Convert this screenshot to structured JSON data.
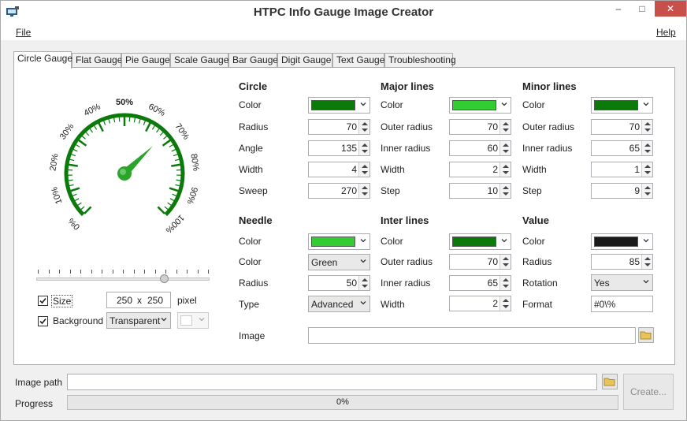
{
  "window": {
    "title": "HTPC Info Gauge Image Creator",
    "controls": [
      "–",
      "□",
      "✕"
    ]
  },
  "menu": {
    "file": "File",
    "help": "Help"
  },
  "tabs": [
    "Circle Gauge",
    "Flat Gauge",
    "Pie Gauge",
    "Scale Gauge",
    "Bar Gauge",
    "Digit Gauge",
    "Text Gauge",
    "Troubleshooting"
  ],
  "active_tab": "Circle Gauge",
  "preview": {
    "gauge_color": "#0b7a0b",
    "needle_color": "#2aa52a",
    "labels": [
      "0%",
      "10%",
      "20%",
      "30%",
      "40%",
      "50%",
      "60%",
      "70%",
      "80%",
      "90%",
      "100%"
    ],
    "value_percent": 67
  },
  "size": {
    "checkbox_label": "Size",
    "checked": true,
    "width": "250",
    "x": "x",
    "height": "250",
    "unit": "pixel",
    "slider_fraction": 0.74
  },
  "background": {
    "checkbox_label": "Background",
    "checked": true,
    "value": "Transparent"
  },
  "circle": {
    "heading": "Circle",
    "color_label": "Color",
    "color": "#0b7a0b",
    "radius_label": "Radius",
    "radius": "70",
    "angle_label": "Angle",
    "angle": "135",
    "width_label": "Width",
    "width": "4",
    "sweep_label": "Sweep",
    "sweep": "270"
  },
  "major_lines": {
    "heading": "Major lines",
    "color_label": "Color",
    "color": "#33cc33",
    "outer_radius_label": "Outer radius",
    "outer_radius": "70",
    "inner_radius_label": "Inner radius",
    "inner_radius": "60",
    "width_label": "Width",
    "width": "2",
    "step_label": "Step",
    "step": "10"
  },
  "minor_lines": {
    "heading": "Minor lines",
    "color_label": "Color",
    "color": "#0b7a0b",
    "outer_radius_label": "Outer radius",
    "outer_radius": "70",
    "inner_radius_label": "Inner radius",
    "inner_radius": "65",
    "width_label": "Width",
    "width": "1",
    "step_label": "Step",
    "step": "9"
  },
  "needle": {
    "heading": "Needle",
    "color_label": "Color",
    "color": "#33cc33",
    "color2_label": "Color",
    "color2": "Green",
    "radius_label": "Radius",
    "radius": "50",
    "type_label": "Type",
    "type": "Advanced"
  },
  "inter_lines": {
    "heading": "Inter lines",
    "color_label": "Color",
    "color": "#0b7a0b",
    "outer_radius_label": "Outer radius",
    "outer_radius": "70",
    "inner_radius_label": "Inner radius",
    "inner_radius": "65",
    "width_label": "Width",
    "width": "2"
  },
  "value": {
    "heading": "Value",
    "color_label": "Color",
    "color": "#1a1a1a",
    "radius_label": "Radius",
    "radius": "85",
    "rotation_label": "Rotation",
    "rotation": "Yes",
    "format_label": "Format",
    "format": "#0\\%"
  },
  "image": {
    "label": "Image",
    "value": ""
  },
  "image_path": {
    "label": "Image path",
    "value": ""
  },
  "progress": {
    "label": "Progress",
    "text": "0%",
    "value": 0
  },
  "create_button": "Create..."
}
